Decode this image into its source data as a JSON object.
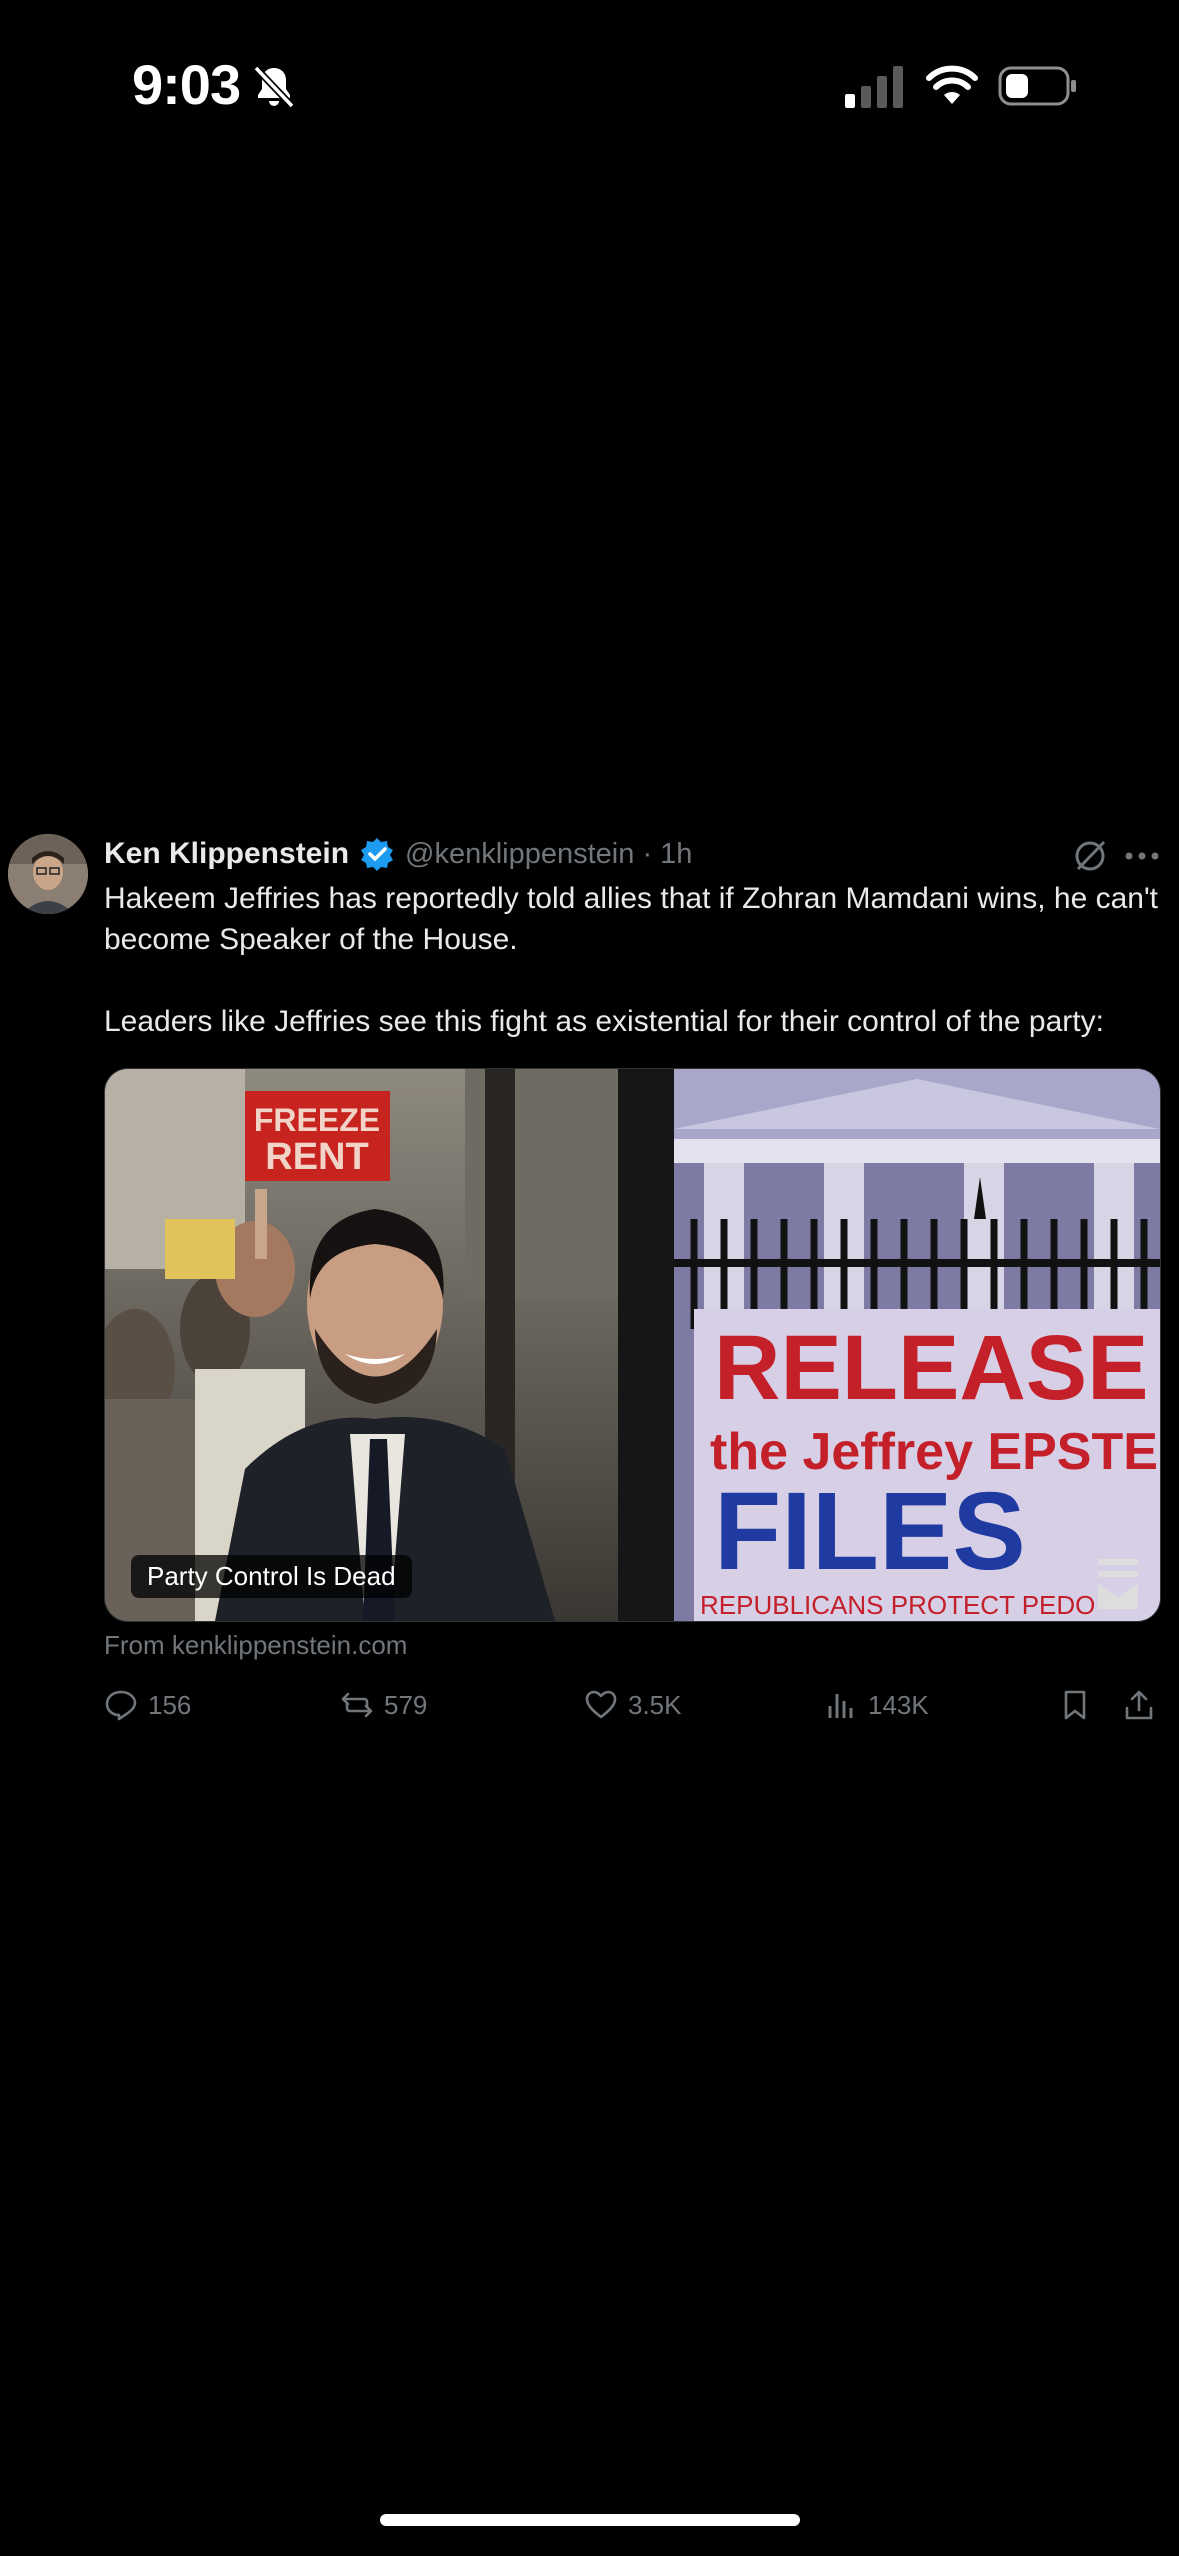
{
  "status_bar": {
    "time": "9:03"
  },
  "tweet": {
    "author_name": "Ken Klippenstein",
    "handle_time": "@kenklippenstein · 1h",
    "text_lines": [
      "Hakeem Jeffries has reportedly told allies that if Zohran Mamdani wins, he can't become Speaker of the House.",
      "Leaders like Jeffries see this fight as existential for their control of the party:"
    ],
    "card": {
      "title": "Party Control Is Dead",
      "source": "From kenklippenstein.com",
      "sign_left_1": "FREEZE",
      "sign_left_2": "RENT",
      "banner_line_1": "RELEASE",
      "banner_line_2": "the Jeffrey EPSTEIN",
      "banner_line_3": "FILES",
      "banner_line_4": "REPUBLICANS PROTECT PEDO"
    },
    "stats": {
      "replies": "156",
      "reposts": "579",
      "likes": "3.5K",
      "views": "143K"
    }
  },
  "colors": {
    "background": "#000000",
    "text": "#e7e9ea",
    "muted": "#71767b",
    "verified": "#1d9bf0"
  }
}
